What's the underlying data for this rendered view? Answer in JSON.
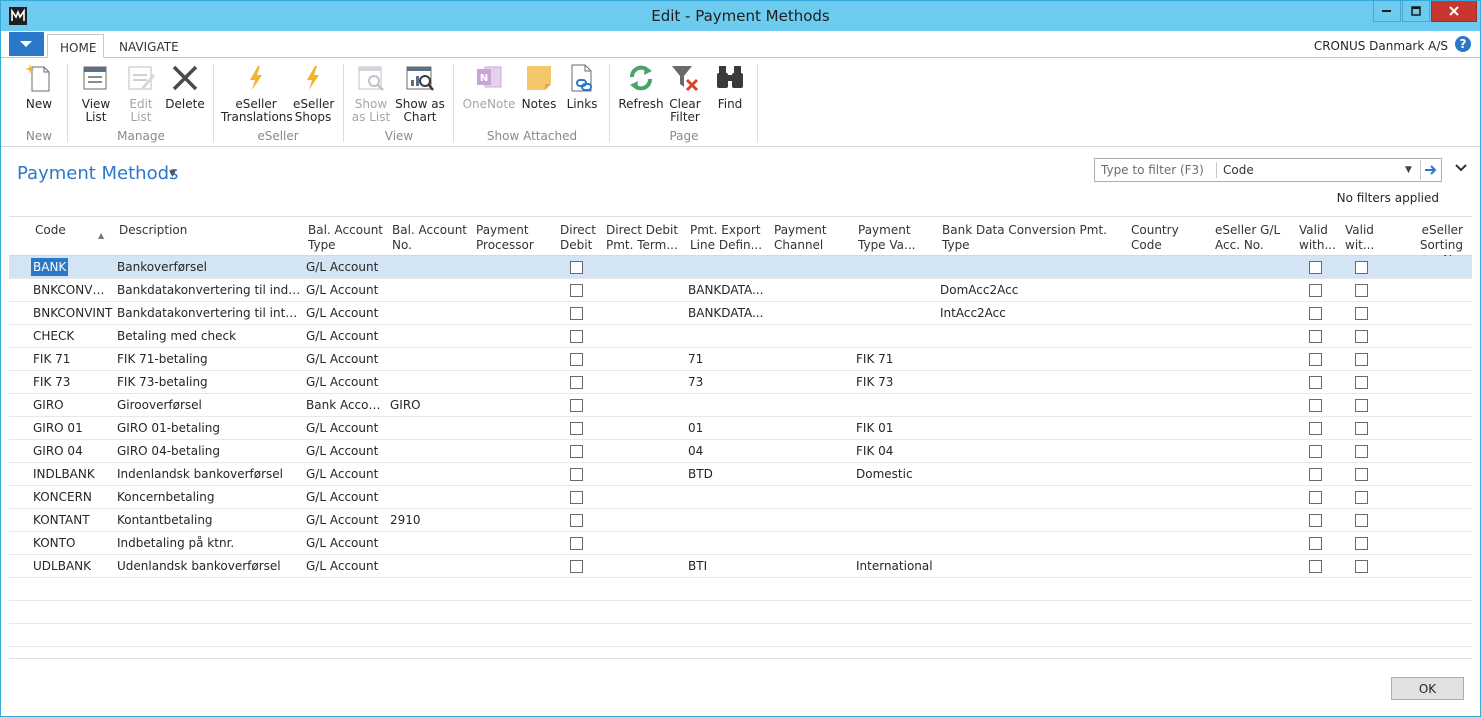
{
  "window": {
    "title": "Edit - Payment Methods"
  },
  "tabs": [
    {
      "label": "HOME"
    },
    {
      "label": "NAVIGATE"
    }
  ],
  "company": "CRONUS Danmark A/S",
  "help_label": "?",
  "ribbon": {
    "buttons": [
      {
        "id": "new",
        "line1": "New",
        "line2": "",
        "icon": "new-icon"
      },
      {
        "id": "view-list",
        "line1": "View",
        "line2": "List",
        "icon": "view-list-icon"
      },
      {
        "id": "edit-list",
        "line1": "Edit",
        "line2": "List",
        "icon": "edit-list-icon",
        "disabled": true
      },
      {
        "id": "delete",
        "line1": "Delete",
        "line2": "",
        "icon": "delete-icon"
      },
      {
        "id": "eseller-translations",
        "line1": "eSeller",
        "line2": "Translations",
        "icon": "lightning-icon"
      },
      {
        "id": "eseller-shops",
        "line1": "eSeller",
        "line2": "Shops",
        "icon": "lightning-icon"
      },
      {
        "id": "show-as-list",
        "line1": "Show",
        "line2": "as List",
        "icon": "show-list-icon",
        "disabled": true
      },
      {
        "id": "show-as-chart",
        "line1": "Show as",
        "line2": "Chart",
        "icon": "chart-icon"
      },
      {
        "id": "onenote",
        "line1": "OneNote",
        "line2": "",
        "icon": "onenote-icon",
        "disabled": true
      },
      {
        "id": "notes",
        "line1": "Notes",
        "line2": "",
        "icon": "notes-icon"
      },
      {
        "id": "links",
        "line1": "Links",
        "line2": "",
        "icon": "links-icon"
      },
      {
        "id": "refresh",
        "line1": "Refresh",
        "line2": "",
        "icon": "refresh-icon"
      },
      {
        "id": "clear-filter",
        "line1": "Clear",
        "line2": "Filter",
        "icon": "clear-filter-icon"
      },
      {
        "id": "find",
        "line1": "Find",
        "line2": "",
        "icon": "binoculars-icon"
      }
    ],
    "groups": [
      "New",
      "Manage",
      "eSeller",
      "View",
      "Show Attached",
      "Page"
    ]
  },
  "page": {
    "title": "Payment Methods",
    "filter": {
      "placeholder": "Type to filter (F3)",
      "field": "Code"
    },
    "no_filters": "No filters applied"
  },
  "columns": [
    {
      "l1": "Code",
      "l2": ""
    },
    {
      "l1": "Description",
      "l2": ""
    },
    {
      "l1": "Bal. Account",
      "l2": "Type"
    },
    {
      "l1": "Bal. Account",
      "l2": "No."
    },
    {
      "l1": "Payment",
      "l2": "Processor"
    },
    {
      "l1": "Direct",
      "l2": "Debit"
    },
    {
      "l1": "Direct Debit",
      "l2": "Pmt. Term..."
    },
    {
      "l1": "Pmt. Export",
      "l2": "Line Defin..."
    },
    {
      "l1": "Payment",
      "l2": "Channel"
    },
    {
      "l1": "Payment",
      "l2": "Type Va..."
    },
    {
      "l1": "Bank Data Conversion Pmt. Type",
      "l2": ""
    },
    {
      "l1": "Country",
      "l2": "Code"
    },
    {
      "l1": "eSeller G/L",
      "l2": "Acc. No."
    },
    {
      "l1": "Valid",
      "l2": "with..."
    },
    {
      "l1": "Valid",
      "l2": "wit..."
    },
    {
      "l1": "eSeller",
      "l2": "Sorting No."
    }
  ],
  "rows": [
    {
      "code": "BANK",
      "desc": "Bankoverførsel",
      "baltype": "G/L Account",
      "balno": "",
      "pmtexp": "",
      "paytype": "",
      "bankconv": ""
    },
    {
      "code": "BNKCONVD...",
      "desc": "Bankdatakonvertering til indenla...",
      "baltype": "G/L Account",
      "balno": "",
      "pmtexp": "BANKDATA...",
      "paytype": "",
      "bankconv": "DomAcc2Acc"
    },
    {
      "code": "BNKCONVINT",
      "desc": "Bankdatakonvertering til internat...",
      "baltype": "G/L Account",
      "balno": "",
      "pmtexp": "BANKDATA...",
      "paytype": "",
      "bankconv": "IntAcc2Acc"
    },
    {
      "code": "CHECK",
      "desc": "Betaling med check",
      "baltype": "G/L Account",
      "balno": "",
      "pmtexp": "",
      "paytype": "",
      "bankconv": ""
    },
    {
      "code": "FIK 71",
      "desc": "FIK 71-betaling",
      "baltype": "G/L Account",
      "balno": "",
      "pmtexp": "71",
      "paytype": "FIK 71",
      "bankconv": ""
    },
    {
      "code": "FIK 73",
      "desc": "FIK 73-betaling",
      "baltype": "G/L Account",
      "balno": "",
      "pmtexp": "73",
      "paytype": "FIK 73",
      "bankconv": ""
    },
    {
      "code": "GIRO",
      "desc": "Girooverførsel",
      "baltype": "Bank Account",
      "balno": "GIRO",
      "pmtexp": "",
      "paytype": "",
      "bankconv": ""
    },
    {
      "code": "GIRO 01",
      "desc": "GIRO 01-betaling",
      "baltype": "G/L Account",
      "balno": "",
      "pmtexp": "01",
      "paytype": "FIK 01",
      "bankconv": ""
    },
    {
      "code": "GIRO 04",
      "desc": "GIRO 04-betaling",
      "baltype": "G/L Account",
      "balno": "",
      "pmtexp": "04",
      "paytype": "FIK 04",
      "bankconv": ""
    },
    {
      "code": "INDLBANK",
      "desc": "Indenlandsk bankoverførsel",
      "baltype": "G/L Account",
      "balno": "",
      "pmtexp": "BTD",
      "paytype": "Domestic",
      "bankconv": ""
    },
    {
      "code": "KONCERN",
      "desc": "Koncernbetaling",
      "baltype": "G/L Account",
      "balno": "",
      "pmtexp": "",
      "paytype": "",
      "bankconv": ""
    },
    {
      "code": "KONTANT",
      "desc": "Kontantbetaling",
      "baltype": "G/L Account",
      "balno": "2910",
      "pmtexp": "",
      "paytype": "",
      "bankconv": ""
    },
    {
      "code": "KONTO",
      "desc": "Indbetaling på ktnr.",
      "baltype": "G/L Account",
      "balno": "",
      "pmtexp": "",
      "paytype": "",
      "bankconv": ""
    },
    {
      "code": "UDLBANK",
      "desc": "Udenlandsk bankoverførsel",
      "baltype": "G/L Account",
      "balno": "",
      "pmtexp": "BTI",
      "paytype": "International",
      "bankconv": ""
    }
  ],
  "ok_label": "OK",
  "colors": {
    "accent": "#2b78c9",
    "titlebar": "#6ccbee",
    "close": "#c7372f",
    "selected_row": "#d3e5f5"
  }
}
